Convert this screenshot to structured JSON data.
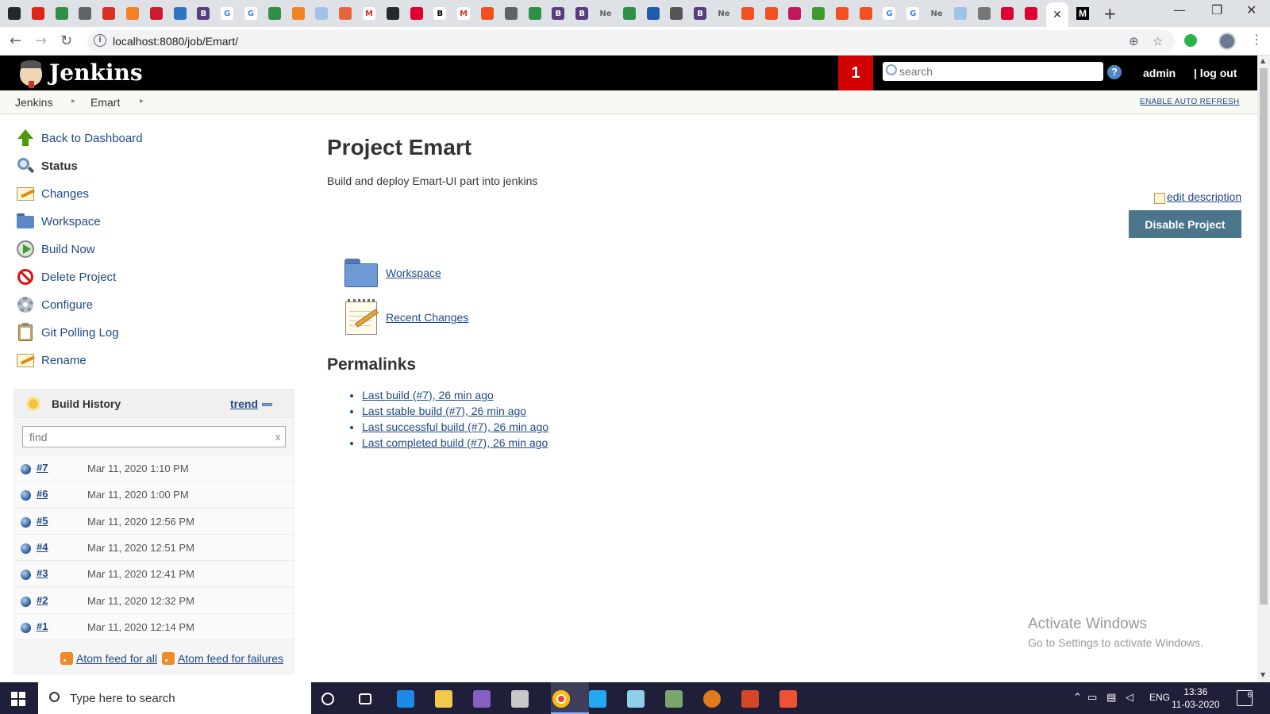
{
  "browser": {
    "tab_favicons": [
      "github-icon",
      "adobe-icon",
      "sheets-icon",
      "chat-icon",
      "duplicate-icon",
      "stackoverflow-icon",
      "opera-icon",
      "typescript-icon",
      "bootstrap-icon",
      "google-icon",
      "google-icon",
      "sheets-icon",
      "stackoverflow-icon",
      "pinwheel-icon",
      "no-icon",
      "gmail-icon",
      "github-icon",
      "angular-icon",
      "bold-b-icon",
      "gmail-icon",
      "microsoft-icon",
      "chat-icon",
      "sheets-icon",
      "bootstrap-icon",
      "bootstrap-icon",
      "ne-icon",
      "sheets-icon",
      "code-icon",
      "octocat-icon",
      "bootstrap-icon",
      "ne-icon",
      "microsoft-icon",
      "microsoft-icon",
      "bug-icon",
      "play-icon",
      "microsoft-icon",
      "microsoft-icon",
      "google-icon",
      "google-icon",
      "ne-icon",
      "pinwheel-icon",
      "globe-icon",
      "angular-icon",
      "angular-icon"
    ],
    "tab_text": {
      "ne": "Ne",
      "b": "B",
      "g": "G",
      "m": "M"
    },
    "active_tab_close": "✕",
    "active_tab_after": "M",
    "new_tab": "+",
    "url": "localhost:8080/job/Emart/",
    "controls": {
      "minimize": "—",
      "restore": "❐",
      "close": "✕"
    }
  },
  "header": {
    "brand": "Jenkins",
    "notification_count": "1",
    "search_placeholder": "search",
    "help": "?",
    "user": "admin",
    "logout": "| log out"
  },
  "breadcrumb": {
    "items": [
      "Jenkins",
      "Emart"
    ],
    "separator": "▸",
    "auto_refresh": "ENABLE AUTO REFRESH"
  },
  "sidebar": {
    "tasks": [
      {
        "label": "Back to Dashboard",
        "icon": "up-arrow-icon"
      },
      {
        "label": "Status",
        "icon": "magnifier-icon"
      },
      {
        "label": "Changes",
        "icon": "notepad-icon"
      },
      {
        "label": "Workspace",
        "icon": "folder-icon"
      },
      {
        "label": "Build Now",
        "icon": "clock-play-icon"
      },
      {
        "label": "Delete Project",
        "icon": "no-entry-icon"
      },
      {
        "label": "Configure",
        "icon": "gear-icon"
      },
      {
        "label": "Git Polling Log",
        "icon": "clipboard-icon"
      },
      {
        "label": "Rename",
        "icon": "notepad-icon"
      }
    ]
  },
  "build_history": {
    "title": "Build History",
    "trend": "trend",
    "filter_placeholder": "find",
    "filter_clear": "x",
    "builds": [
      {
        "number": "#7",
        "date": "Mar 11, 2020 1:10 PM"
      },
      {
        "number": "#6",
        "date": "Mar 11, 2020 1:00 PM"
      },
      {
        "number": "#5",
        "date": "Mar 11, 2020 12:56 PM"
      },
      {
        "number": "#4",
        "date": "Mar 11, 2020 12:51 PM"
      },
      {
        "number": "#3",
        "date": "Mar 11, 2020 12:41 PM"
      },
      {
        "number": "#2",
        "date": "Mar 11, 2020 12:32 PM"
      },
      {
        "number": "#1",
        "date": "Mar 11, 2020 12:14 PM"
      }
    ],
    "feed_all": "Atom feed for all",
    "feed_failures": "Atom feed for failures"
  },
  "main": {
    "title": "Project Emart",
    "description": "Build and deploy Emart-UI part into jenkins",
    "edit_description": "edit description",
    "disable_button": "Disable Project",
    "links": [
      {
        "label": "Workspace",
        "icon": "folder-icon"
      },
      {
        "label": "Recent Changes",
        "icon": "notepad-pencil-icon"
      }
    ],
    "permalinks_title": "Permalinks",
    "permalinks": [
      "Last build (#7), 26 min ago",
      "Last stable build (#7), 26 min ago",
      "Last successful build (#7), 26 min ago",
      "Last completed build (#7), 26 min ago"
    ]
  },
  "watermark": {
    "line1": "Activate Windows",
    "line2": "Go to Settings to activate Windows."
  },
  "taskbar": {
    "search_placeholder": "Type here to search",
    "apps": [
      "cortana-icon",
      "task-view-icon",
      "edge-icon",
      "file-explorer-icon",
      "visual-studio-icon",
      "snipping-tool-icon",
      "chrome-icon",
      "vscode-icon",
      "notepad-icon",
      "files-icon",
      "download-icon",
      "powerpoint-icon",
      "git-icon"
    ],
    "tray": {
      "language": "ENG",
      "time": "13:36",
      "date": "11-03-2020",
      "notifications": "6"
    }
  },
  "colors": {
    "jenkins_header": "#000000",
    "notification_badge": "#d20000",
    "link": "#204a87",
    "disable_button": "#4b758b",
    "build_ball": "#3465a4",
    "taskbar": "#1f1f3a"
  }
}
